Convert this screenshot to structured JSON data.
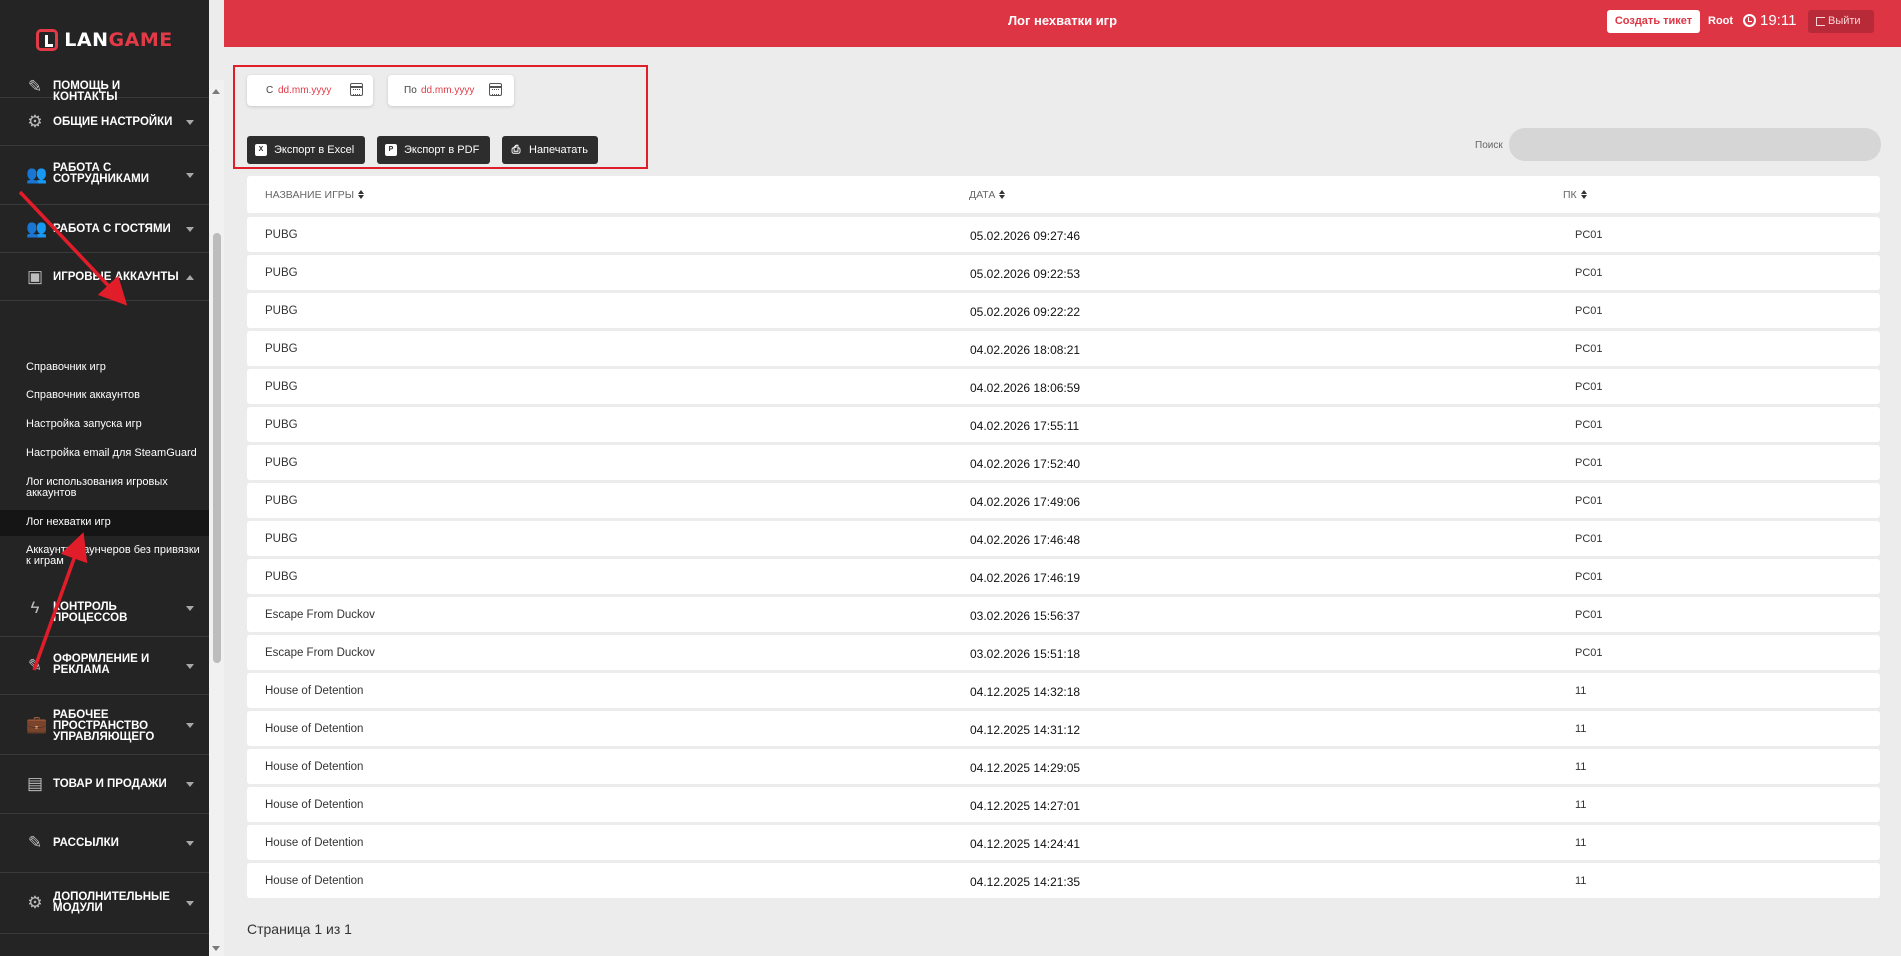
{
  "brand": {
    "prefix": "LAN",
    "suffix": "GAME"
  },
  "header": {
    "title": "Лог нехватки игр",
    "ticket_label": "Создать тикет",
    "user": "Root",
    "time": "19:11",
    "logout_label": "Выйти"
  },
  "sidebar": {
    "items": [
      {
        "label": "Помощь и контакты",
        "icon": "edit-icon"
      },
      {
        "label": "Общие настройки",
        "icon": "gear-icon"
      },
      {
        "label": "Работа с сотрудниками",
        "icon": "users-icon"
      },
      {
        "label": "Работа с гостями",
        "icon": "guests-icon"
      },
      {
        "label": "Игровые аккаунты",
        "icon": "account-icon",
        "expanded": true
      },
      {
        "label": "Контроль процессов",
        "icon": "bolt-icon"
      },
      {
        "label": "Оформление и реклама",
        "icon": "edit-icon"
      },
      {
        "label": "Рабочее пространство управляющего",
        "icon": "briefcase-icon"
      },
      {
        "label": "Товар и продажи",
        "icon": "note-icon"
      },
      {
        "label": "Рассылки",
        "icon": "edit-icon"
      },
      {
        "label": "Дополнительные модули",
        "icon": "gear-icon"
      }
    ],
    "subitems": [
      {
        "label": "Справочник игр"
      },
      {
        "label": "Справочник аккаунтов"
      },
      {
        "label": "Настройка запуска игр"
      },
      {
        "label": "Настройка email для SteamGuard"
      },
      {
        "label": "Лог использования игровых аккаунтов"
      },
      {
        "label": "Лог нехватки игр",
        "active": true
      },
      {
        "label": "Аккаунты лаунчеров без привязки к играм"
      }
    ]
  },
  "filters": {
    "from_prefix": "С",
    "from_placeholder": "dd.mm.yyyy",
    "to_prefix": "По",
    "to_placeholder": "dd.mm.yyyy"
  },
  "actions": {
    "excel": "Экспорт в Excel",
    "pdf": "Экспорт в PDF",
    "print": "Напечатать"
  },
  "search": {
    "label": "Поиск"
  },
  "table": {
    "columns": [
      "Название игры",
      "Дата",
      "ПК"
    ],
    "rows": [
      [
        "PUBG",
        "05.02.2026 09:27:46",
        "PC01"
      ],
      [
        "PUBG",
        "05.02.2026 09:22:53",
        "PC01"
      ],
      [
        "PUBG",
        "05.02.2026 09:22:22",
        "PC01"
      ],
      [
        "PUBG",
        "04.02.2026 18:08:21",
        "PC01"
      ],
      [
        "PUBG",
        "04.02.2026 18:06:59",
        "PC01"
      ],
      [
        "PUBG",
        "04.02.2026 17:55:11",
        "PC01"
      ],
      [
        "PUBG",
        "04.02.2026 17:52:40",
        "PC01"
      ],
      [
        "PUBG",
        "04.02.2026 17:49:06",
        "PC01"
      ],
      [
        "PUBG",
        "04.02.2026 17:46:48",
        "PC01"
      ],
      [
        "PUBG",
        "04.02.2026 17:46:19",
        "PC01"
      ],
      [
        "Escape From Duckov",
        "03.02.2026 15:56:37",
        "PC01"
      ],
      [
        "Escape From Duckov",
        "03.02.2026 15:51:18",
        "PC01"
      ],
      [
        "House of Detention",
        "04.12.2025 14:32:18",
        "11"
      ],
      [
        "House of Detention",
        "04.12.2025 14:31:12",
        "11"
      ],
      [
        "House of Detention",
        "04.12.2025 14:29:05",
        "11"
      ],
      [
        "House of Detention",
        "04.12.2025 14:27:01",
        "11"
      ],
      [
        "House of Detention",
        "04.12.2025 14:24:41",
        "11"
      ],
      [
        "House of Detention",
        "04.12.2025 14:21:35",
        "11"
      ]
    ]
  },
  "pagination": {
    "text": "Страница 1 из 1"
  },
  "colors": {
    "accent": "#de3545",
    "sidebar": "#242424",
    "annotation": "#e21d2a"
  }
}
